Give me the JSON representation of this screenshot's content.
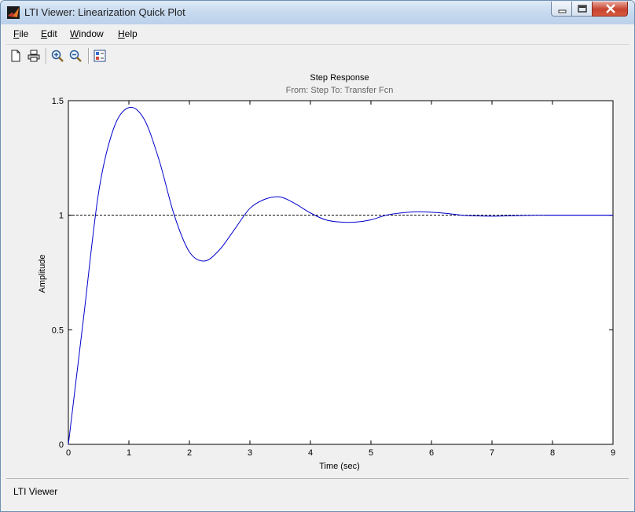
{
  "window": {
    "title": "LTI Viewer: Linearization Quick Plot"
  },
  "menu": {
    "file": {
      "mnemonic": "F",
      "rest": "ile"
    },
    "edit": {
      "mnemonic": "E",
      "rest": "dit"
    },
    "window": {
      "mnemonic": "W",
      "rest": "indow"
    },
    "help": {
      "mnemonic": "H",
      "rest": "elp"
    }
  },
  "toolbar": [
    "new-icon",
    "print-icon",
    "zoom-in-icon",
    "zoom-out-icon",
    "plot-configuration-icon"
  ],
  "status": {
    "text": "LTI Viewer"
  },
  "colors": {
    "response": "#0000cc",
    "reference": "#000000",
    "subtitle": "#666666"
  },
  "chart_data": {
    "type": "line",
    "title": "Step Response",
    "subtitle": "From: Step  To: Transfer Fcn",
    "xlabel": "Time (sec)",
    "ylabel": "Amplitude",
    "xlim": [
      0,
      9
    ],
    "ylim": [
      0,
      1.5
    ],
    "xticks": [
      "0",
      "1",
      "2",
      "3",
      "4",
      "5",
      "6",
      "7",
      "8",
      "9"
    ],
    "yticks": [
      "0",
      "0.5",
      "1",
      "1.5"
    ],
    "grid": false,
    "reference_line": {
      "y": 1,
      "x_end": 7.9,
      "style": "dashed"
    },
    "series": [
      {
        "x": [
          0,
          0.25,
          0.5,
          0.75,
          1.0,
          1.25,
          1.5,
          1.75,
          2.0,
          2.25,
          2.5,
          2.75,
          3.0,
          3.25,
          3.5,
          3.75,
          4.0,
          4.25,
          4.5,
          4.75,
          5.0,
          5.25,
          5.5,
          5.75,
          6.0,
          6.25,
          6.5,
          6.75,
          7.0,
          7.25,
          7.5,
          7.75,
          8.0,
          8.5,
          9.0
        ],
        "y": [
          0,
          0.55,
          1.1,
          1.38,
          1.47,
          1.42,
          1.24,
          1.0,
          0.84,
          0.8,
          0.85,
          0.94,
          1.03,
          1.07,
          1.08,
          1.05,
          1.01,
          0.98,
          0.97,
          0.97,
          0.98,
          1.0,
          1.01,
          1.015,
          1.013,
          1.008,
          1.0,
          0.997,
          0.996,
          0.997,
          0.999,
          1.0,
          1.0,
          1.0,
          1.0
        ]
      }
    ]
  }
}
